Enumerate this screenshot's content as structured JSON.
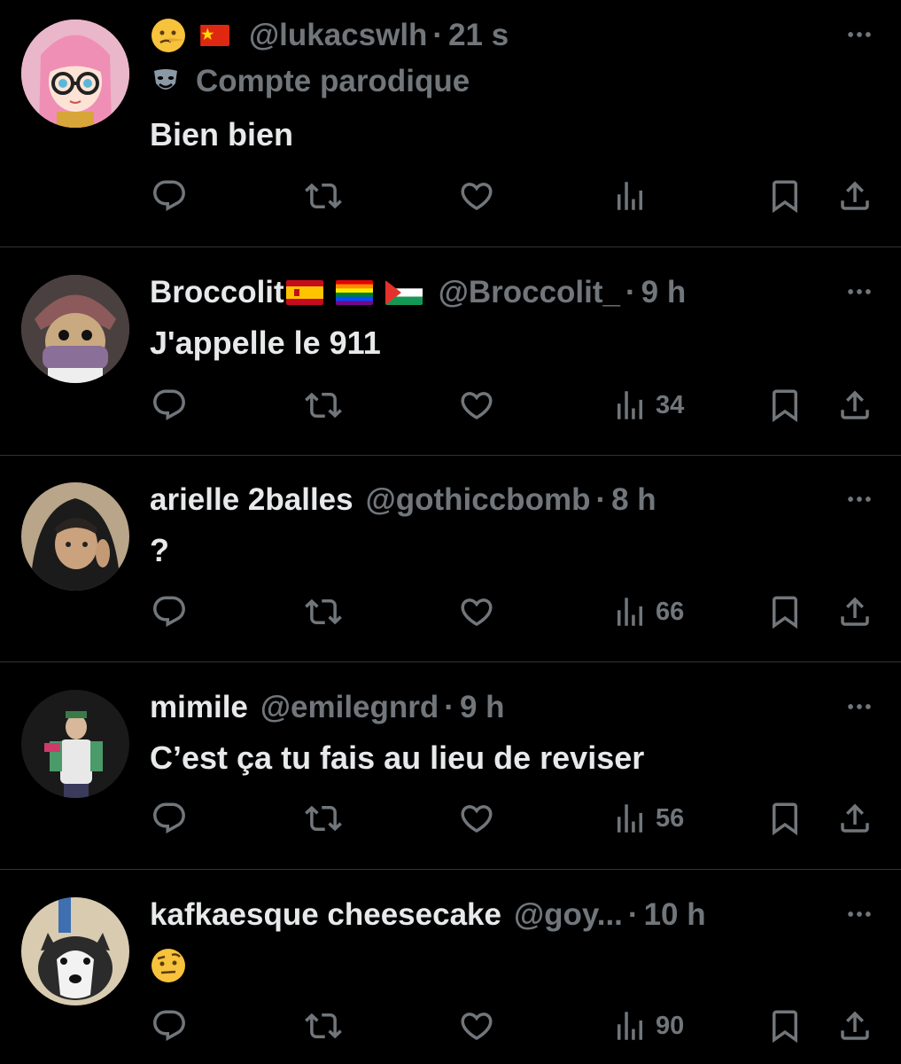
{
  "tweets": [
    {
      "name": "",
      "handle": "@lukacswlh",
      "time": "21 s",
      "badge": "Compte parodique",
      "text": "Bien bien",
      "views": "",
      "avatar_color": "#f4a7c8"
    },
    {
      "name": "Broccolit",
      "handle": "@Broccolit_",
      "time": "9 h",
      "text": "J'appelle le 911",
      "views": "34",
      "avatar_color": "#6a5a5a"
    },
    {
      "name": "arielle 2balles",
      "handle": "@gothiccbomb",
      "time": "8 h",
      "text": "?",
      "views": "66",
      "avatar_color": "#b8a58a"
    },
    {
      "name": "mimile",
      "handle": "@emilegnrd",
      "time": "9 h",
      "text": "C’est ça tu fais au lieu de reviser",
      "views": "56",
      "avatar_color": "#1a1a1a"
    },
    {
      "name": "kafkaesque cheesecake",
      "handle": "@goy...",
      "time": "10 h",
      "text": "",
      "views": "90",
      "avatar_color": "#d8cbb0"
    }
  ],
  "separator": "·",
  "colors": {
    "background": "#000000",
    "text": "#e7e9ea",
    "muted": "#71767b",
    "divider": "#2f3336"
  },
  "icons": [
    "reply-icon",
    "retweet-icon",
    "like-icon",
    "views-icon",
    "bookmark-icon",
    "share-icon",
    "more-icon"
  ]
}
